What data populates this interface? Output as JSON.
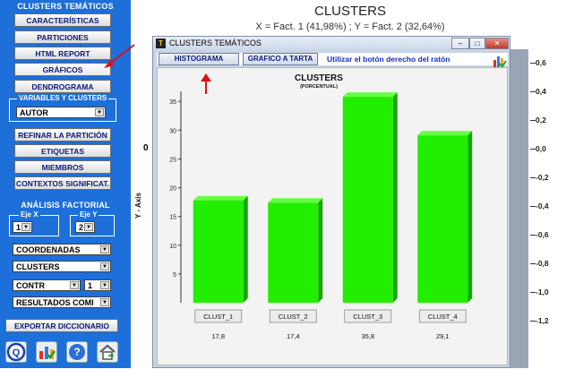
{
  "sidebar": {
    "section_clusters": "CLUSTERS TEMÁTICOS",
    "buttons": [
      "CARACTERÍSTICAS",
      "PARTICIONES",
      "HTML REPORT",
      "GRÁFICOS",
      "DENDROGRAMA"
    ],
    "variables_legend": "VARIABLES Y CLUSTERS",
    "autor_select": "AUTOR",
    "buttons2": [
      "REFINAR LA PARTICIÓN",
      "ETIQUETAS",
      "MIEMBROS",
      "CONTEXTOS SIGNIFICAT."
    ],
    "section_factorial": "ANÁLISIS FACTORIAL",
    "eje_x_label": "Eje X",
    "eje_y_label": "Eje Y",
    "eje_x_value": "1",
    "eje_y_value": "2",
    "coordenadas_select": "COORDENADAS",
    "clusters_select": "CLUSTERS",
    "contr_select": "CONTR",
    "contr_num": "1",
    "resultados_select": "RESULTADOS COMI",
    "export_button": "EXPORTAR DICCIONARIO"
  },
  "background_plot": {
    "title": "CLUSTERS",
    "subtitle": "X = Fact. 1 (41,98%) ; Y = Fact. 2 (32,64%)",
    "y_axis_label": "Y - Axis",
    "zero_label": "0",
    "ticks": [
      "0,6",
      "0,4",
      "0,2",
      "0,0",
      "-0,2",
      "-0,4",
      "-0,6",
      "-0,8",
      "-1,0",
      "-1,2"
    ]
  },
  "window": {
    "title": "CLUSTERS TEMÁTICOS",
    "tabs": [
      "HISTOGRAMA",
      "GRAFICO A TARTA"
    ],
    "hint": "Utilizar el botón derecho del ratón",
    "controls": {
      "minimize": "–",
      "maximize": "□",
      "close": "✕"
    }
  },
  "chart_data": {
    "type": "bar",
    "title": "CLUSTERS",
    "subtitle": "(PORCENTUAL)",
    "categories": [
      "CLUST_1",
      "CLUST_2",
      "CLUST_3",
      "CLUST_4"
    ],
    "values": [
      17.8,
      17.4,
      35.8,
      29.1
    ],
    "value_labels": [
      "17,8",
      "17,4",
      "35,8",
      "29,1"
    ],
    "ylim": [
      0,
      35
    ],
    "yticks": [
      5,
      10,
      15,
      20,
      25,
      30,
      35
    ],
    "bar_color": "#22ee00"
  },
  "icons": [
    "help-q-icon",
    "chart-icon",
    "question-icon",
    "home-icon"
  ]
}
